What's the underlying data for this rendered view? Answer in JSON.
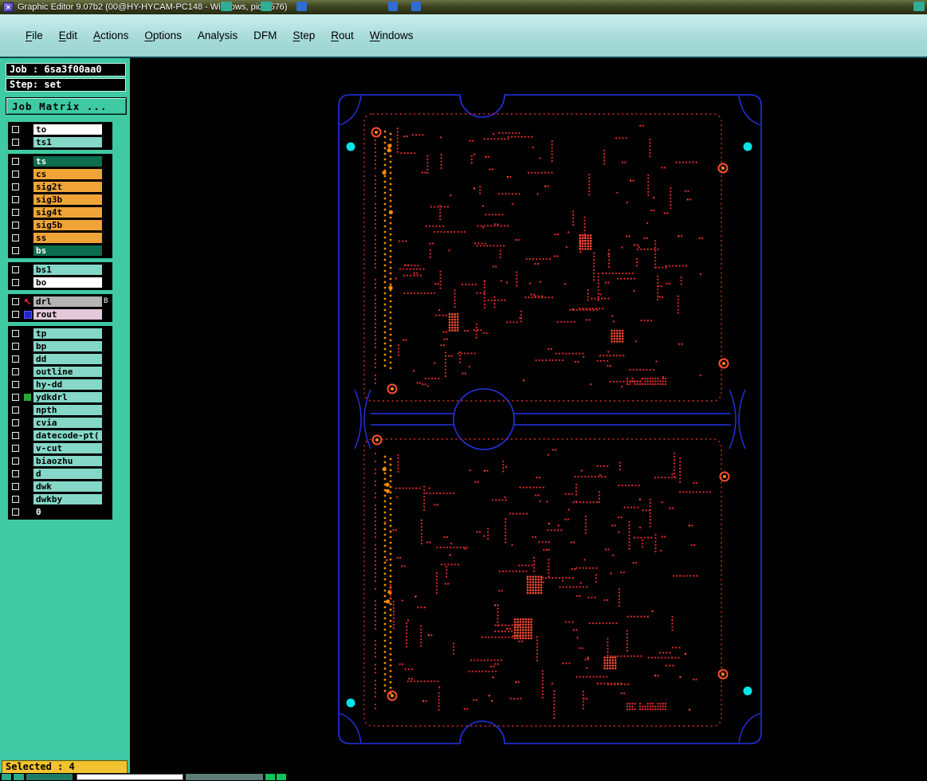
{
  "window": {
    "title": "Graphic Editor 9.07b2 (00@HY-HYCAM-PC148 - Windows, pid:1576)"
  },
  "menu": {
    "items": [
      {
        "label": "File",
        "mnemonic": 0
      },
      {
        "label": "Edit",
        "mnemonic": 0
      },
      {
        "label": "Actions",
        "mnemonic": 0
      },
      {
        "label": "Options",
        "mnemonic": 0
      },
      {
        "label": "Analysis",
        "mnemonic": -1
      },
      {
        "label": "DFM",
        "mnemonic": -1
      },
      {
        "label": "Step",
        "mnemonic": 0
      },
      {
        "label": "Rout",
        "mnemonic": 0
      },
      {
        "label": "Windows",
        "mnemonic": 0
      }
    ]
  },
  "sidebar": {
    "job_label": "Job : 6sa3f00aa0",
    "step_label": "Step: set",
    "job_matrix_button": "Job Matrix ...",
    "selected_label": "Selected : 4",
    "layer_groups": [
      {
        "layers": [
          {
            "name": "to",
            "style": "white"
          },
          {
            "name": "ts1",
            "style": "teal"
          }
        ]
      },
      {
        "layers": [
          {
            "name": "ts",
            "style": "selected"
          },
          {
            "name": "cs",
            "style": "orange"
          },
          {
            "name": "sig2t",
            "style": "orange"
          },
          {
            "name": "sig3b",
            "style": "orange"
          },
          {
            "name": "sig4t",
            "style": "orange"
          },
          {
            "name": "sig5b",
            "style": "orange"
          },
          {
            "name": "ss",
            "style": "orange"
          },
          {
            "name": "bs",
            "style": "selected"
          }
        ]
      },
      {
        "layers": [
          {
            "name": "bs1",
            "style": "teal"
          },
          {
            "name": "bo",
            "style": "white"
          }
        ]
      },
      {
        "layers": [
          {
            "name": "drl",
            "style": "drill",
            "icon": "red-arrow",
            "badge": "B"
          },
          {
            "name": "rout",
            "style": "rout",
            "icon": "blue-square"
          }
        ]
      },
      {
        "layers": [
          {
            "name": "tp",
            "style": "teal"
          },
          {
            "name": "bp",
            "style": "teal"
          },
          {
            "name": "dd",
            "style": "teal"
          },
          {
            "name": "outline",
            "style": "teal"
          },
          {
            "name": "hy-dd",
            "style": "teal"
          },
          {
            "name": "ydkdrl",
            "style": "teal",
            "icon": "green-square"
          },
          {
            "name": "npth",
            "style": "teal"
          },
          {
            "name": "cvia",
            "style": "teal"
          },
          {
            "name": "datecode-pt(",
            "style": "teal"
          },
          {
            "name": "v-cut",
            "style": "teal"
          },
          {
            "name": "biaozhu",
            "style": "teal"
          },
          {
            "name": "d",
            "style": "teal"
          },
          {
            "name": "dwk",
            "style": "teal"
          },
          {
            "name": "dwkby",
            "style": "teal"
          },
          {
            "name": "0",
            "style": "black"
          }
        ]
      }
    ]
  },
  "canvas": {
    "colors": {
      "background": "#000000",
      "outline_blue": "#2633e6",
      "trace_red": "#d92b2b",
      "bright_red": "#ff4d33",
      "orange": "#ff8a00",
      "cyan": "#00e5e5"
    }
  },
  "ui_colors": {
    "titlebar": "#3c441f",
    "menubar": "#a5dad8",
    "sidebar_teal": "#3fcaa3",
    "layer_teal": "#85d7c7",
    "layer_orange": "#f0a437",
    "layer_selected_green": "#0c6e4e",
    "selected_yellow": "#f2c230"
  }
}
